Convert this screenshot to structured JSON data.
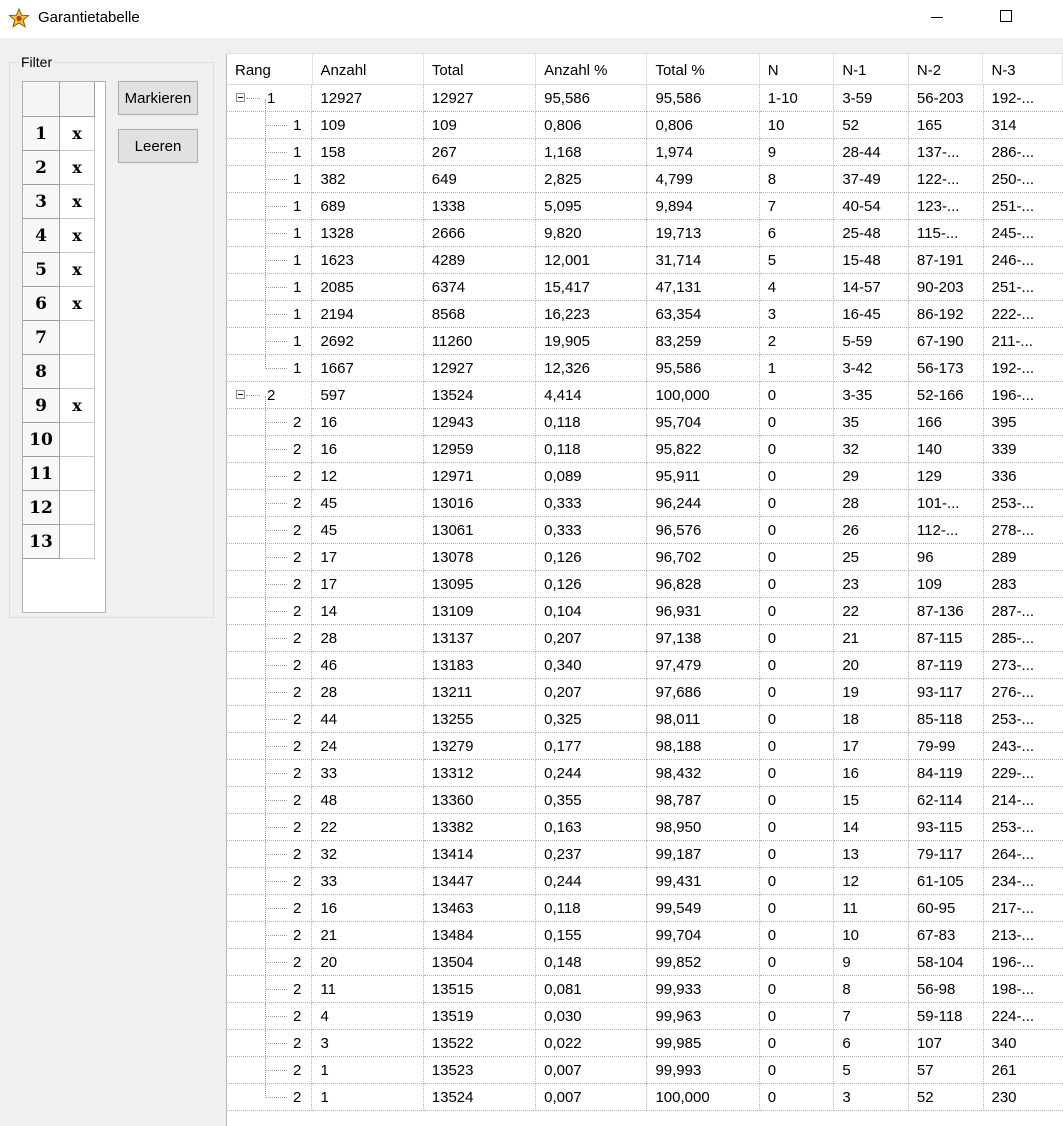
{
  "window": {
    "title": "Garantietabelle",
    "icon": "star-app-icon",
    "controls": [
      "minimize-icon",
      "maximize-icon"
    ]
  },
  "filter": {
    "legend": "Filter",
    "rows": [
      {
        "num": "1",
        "val": "x"
      },
      {
        "num": "2",
        "val": "x"
      },
      {
        "num": "3",
        "val": "x"
      },
      {
        "num": "4",
        "val": "x"
      },
      {
        "num": "5",
        "val": "x"
      },
      {
        "num": "6",
        "val": "x"
      },
      {
        "num": "7",
        "val": ""
      },
      {
        "num": "8",
        "val": ""
      },
      {
        "num": "9",
        "val": "x"
      },
      {
        "num": "10",
        "val": ""
      },
      {
        "num": "11",
        "val": ""
      },
      {
        "num": "12",
        "val": ""
      },
      {
        "num": "13",
        "val": ""
      }
    ],
    "buttons": {
      "mark": "Markieren",
      "clear": "Leeren"
    }
  },
  "table": {
    "columns": [
      "Rang",
      "Anzahl",
      "Total",
      "Anzahl %",
      "Total %",
      "N",
      "N-1",
      "N-2",
      "N-3"
    ],
    "rows": [
      {
        "level": 0,
        "expander": true,
        "cells": [
          "1",
          "12927",
          "12927",
          "95,586",
          "95,586",
          "1-10",
          "3-59",
          "56-203",
          "192-..."
        ]
      },
      {
        "level": 1,
        "cells": [
          "1",
          "109",
          "109",
          "0,806",
          "0,806",
          "10",
          "52",
          "165",
          "314"
        ]
      },
      {
        "level": 1,
        "cells": [
          "1",
          "158",
          "267",
          "1,168",
          "1,974",
          "9",
          "28-44",
          "137-...",
          "286-..."
        ]
      },
      {
        "level": 1,
        "cells": [
          "1",
          "382",
          "649",
          "2,825",
          "4,799",
          "8",
          "37-49",
          "122-...",
          "250-..."
        ]
      },
      {
        "level": 1,
        "cells": [
          "1",
          "689",
          "1338",
          "5,095",
          "9,894",
          "7",
          "40-54",
          "123-...",
          "251-..."
        ]
      },
      {
        "level": 1,
        "cells": [
          "1",
          "1328",
          "2666",
          "9,820",
          "19,713",
          "6",
          "25-48",
          "115-...",
          "245-..."
        ]
      },
      {
        "level": 1,
        "cells": [
          "1",
          "1623",
          "4289",
          "12,001",
          "31,714",
          "5",
          "15-48",
          "87-191",
          "246-..."
        ]
      },
      {
        "level": 1,
        "cells": [
          "1",
          "2085",
          "6374",
          "15,417",
          "47,131",
          "4",
          "14-57",
          "90-203",
          "251-..."
        ]
      },
      {
        "level": 1,
        "cells": [
          "1",
          "2194",
          "8568",
          "16,223",
          "63,354",
          "3",
          "16-45",
          "86-192",
          "222-..."
        ]
      },
      {
        "level": 1,
        "cells": [
          "1",
          "2692",
          "11260",
          "19,905",
          "83,259",
          "2",
          "5-59",
          "67-190",
          "211-..."
        ]
      },
      {
        "level": 1,
        "last": true,
        "cells": [
          "1",
          "1667",
          "12927",
          "12,326",
          "95,586",
          "1",
          "3-42",
          "56-173",
          "192-..."
        ]
      },
      {
        "level": 0,
        "expander": true,
        "cells": [
          "2",
          "597",
          "13524",
          "4,414",
          "100,000",
          "0",
          "3-35",
          "52-166",
          "196-..."
        ]
      },
      {
        "level": 1,
        "cells": [
          "2",
          "16",
          "12943",
          "0,118",
          "95,704",
          "0",
          "35",
          "166",
          "395"
        ]
      },
      {
        "level": 1,
        "cells": [
          "2",
          "16",
          "12959",
          "0,118",
          "95,822",
          "0",
          "32",
          "140",
          "339"
        ]
      },
      {
        "level": 1,
        "cells": [
          "2",
          "12",
          "12971",
          "0,089",
          "95,911",
          "0",
          "29",
          "129",
          "336"
        ]
      },
      {
        "level": 1,
        "cells": [
          "2",
          "45",
          "13016",
          "0,333",
          "96,244",
          "0",
          "28",
          "101-...",
          "253-..."
        ]
      },
      {
        "level": 1,
        "cells": [
          "2",
          "45",
          "13061",
          "0,333",
          "96,576",
          "0",
          "26",
          "112-...",
          "278-..."
        ]
      },
      {
        "level": 1,
        "cells": [
          "2",
          "17",
          "13078",
          "0,126",
          "96,702",
          "0",
          "25",
          "96",
          "289"
        ]
      },
      {
        "level": 1,
        "cells": [
          "2",
          "17",
          "13095",
          "0,126",
          "96,828",
          "0",
          "23",
          "109",
          "283"
        ]
      },
      {
        "level": 1,
        "cells": [
          "2",
          "14",
          "13109",
          "0,104",
          "96,931",
          "0",
          "22",
          "87-136",
          "287-..."
        ]
      },
      {
        "level": 1,
        "cells": [
          "2",
          "28",
          "13137",
          "0,207",
          "97,138",
          "0",
          "21",
          "87-115",
          "285-..."
        ]
      },
      {
        "level": 1,
        "cells": [
          "2",
          "46",
          "13183",
          "0,340",
          "97,479",
          "0",
          "20",
          "87-119",
          "273-..."
        ]
      },
      {
        "level": 1,
        "cells": [
          "2",
          "28",
          "13211",
          "0,207",
          "97,686",
          "0",
          "19",
          "93-117",
          "276-..."
        ]
      },
      {
        "level": 1,
        "cells": [
          "2",
          "44",
          "13255",
          "0,325",
          "98,011",
          "0",
          "18",
          "85-118",
          "253-..."
        ]
      },
      {
        "level": 1,
        "cells": [
          "2",
          "24",
          "13279",
          "0,177",
          "98,188",
          "0",
          "17",
          "79-99",
          "243-..."
        ]
      },
      {
        "level": 1,
        "cells": [
          "2",
          "33",
          "13312",
          "0,244",
          "98,432",
          "0",
          "16",
          "84-119",
          "229-..."
        ]
      },
      {
        "level": 1,
        "cells": [
          "2",
          "48",
          "13360",
          "0,355",
          "98,787",
          "0",
          "15",
          "62-114",
          "214-..."
        ]
      },
      {
        "level": 1,
        "cells": [
          "2",
          "22",
          "13382",
          "0,163",
          "98,950",
          "0",
          "14",
          "93-115",
          "253-..."
        ]
      },
      {
        "level": 1,
        "cells": [
          "2",
          "32",
          "13414",
          "0,237",
          "99,187",
          "0",
          "13",
          "79-117",
          "264-..."
        ]
      },
      {
        "level": 1,
        "cells": [
          "2",
          "33",
          "13447",
          "0,244",
          "99,431",
          "0",
          "12",
          "61-105",
          "234-..."
        ]
      },
      {
        "level": 1,
        "cells": [
          "2",
          "16",
          "13463",
          "0,118",
          "99,549",
          "0",
          "11",
          "60-95",
          "217-..."
        ]
      },
      {
        "level": 1,
        "cells": [
          "2",
          "21",
          "13484",
          "0,155",
          "99,704",
          "0",
          "10",
          "67-83",
          "213-..."
        ]
      },
      {
        "level": 1,
        "cells": [
          "2",
          "20",
          "13504",
          "0,148",
          "99,852",
          "0",
          "9",
          "58-104",
          "196-..."
        ]
      },
      {
        "level": 1,
        "cells": [
          "2",
          "11",
          "13515",
          "0,081",
          "99,933",
          "0",
          "8",
          "56-98",
          "198-..."
        ]
      },
      {
        "level": 1,
        "cells": [
          "2",
          "4",
          "13519",
          "0,030",
          "99,963",
          "0",
          "7",
          "59-118",
          "224-..."
        ]
      },
      {
        "level": 1,
        "cells": [
          "2",
          "3",
          "13522",
          "0,022",
          "99,985",
          "0",
          "6",
          "107",
          "340"
        ]
      },
      {
        "level": 1,
        "cells": [
          "2",
          "1",
          "13523",
          "0,007",
          "99,993",
          "0",
          "5",
          "57",
          "261"
        ]
      },
      {
        "level": 1,
        "last": true,
        "cells": [
          "2",
          "1",
          "13524",
          "0,007",
          "100,000",
          "0",
          "3",
          "52",
          "230"
        ]
      }
    ]
  }
}
